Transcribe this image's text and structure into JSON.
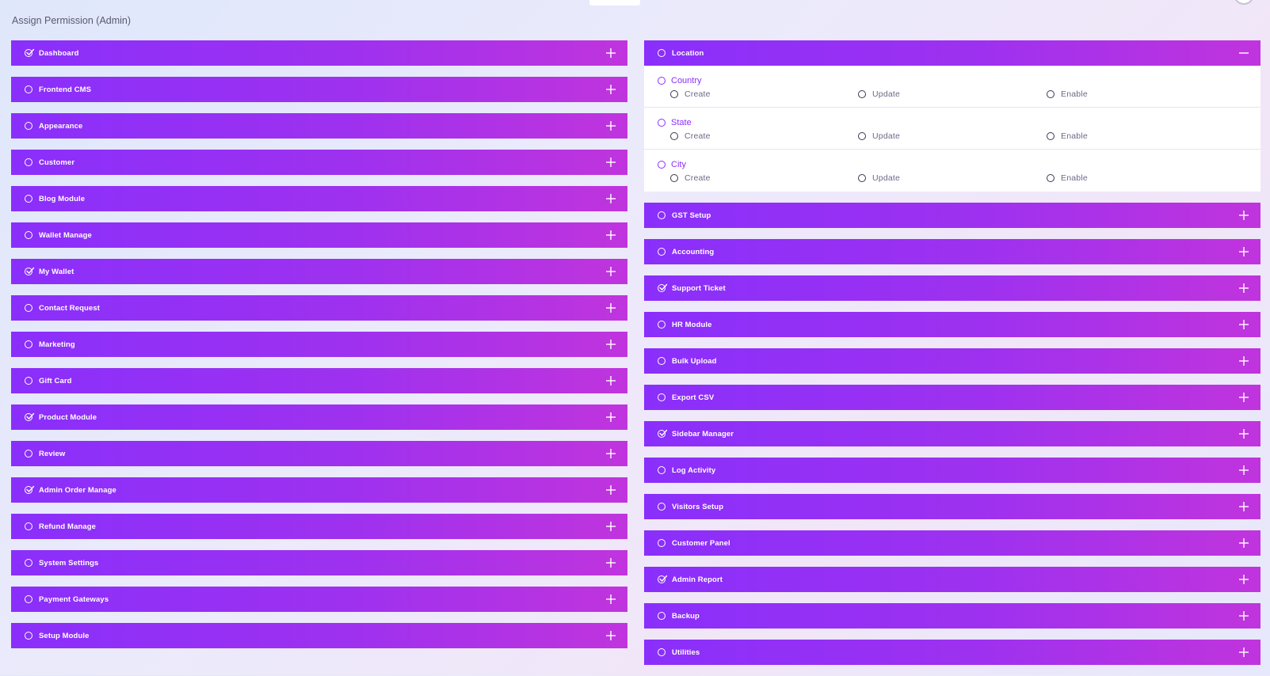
{
  "page": {
    "title": "Assign Permission (Admin)"
  },
  "left_modules": [
    {
      "label": "Dashboard",
      "checked": true,
      "expanded": false
    },
    {
      "label": "Frontend CMS",
      "checked": false,
      "expanded": false
    },
    {
      "label": "Appearance",
      "checked": false,
      "expanded": false
    },
    {
      "label": "Customer",
      "checked": false,
      "expanded": false
    },
    {
      "label": "Blog Module",
      "checked": false,
      "expanded": false
    },
    {
      "label": "Wallet Manage",
      "checked": false,
      "expanded": false
    },
    {
      "label": "My Wallet",
      "checked": true,
      "expanded": false
    },
    {
      "label": "Contact Request",
      "checked": false,
      "expanded": false
    },
    {
      "label": "Marketing",
      "checked": false,
      "expanded": false
    },
    {
      "label": "Gift Card",
      "checked": false,
      "expanded": false
    },
    {
      "label": "Product Module",
      "checked": true,
      "expanded": false
    },
    {
      "label": "Review",
      "checked": false,
      "expanded": false
    },
    {
      "label": "Admin Order Manage",
      "checked": true,
      "expanded": false
    },
    {
      "label": "Refund Manage",
      "checked": false,
      "expanded": false
    },
    {
      "label": "System Settings",
      "checked": false,
      "expanded": false
    },
    {
      "label": "Payment Gateways",
      "checked": false,
      "expanded": false
    },
    {
      "label": "Setup Module",
      "checked": false,
      "expanded": false
    }
  ],
  "right_modules": [
    {
      "label": "Location",
      "checked": false,
      "expanded": true,
      "groups": [
        {
          "label": "Country",
          "actions": [
            "Create",
            "Update",
            "Enable"
          ]
        },
        {
          "label": "State",
          "actions": [
            "Create",
            "Update",
            "Enable"
          ]
        },
        {
          "label": "City",
          "actions": [
            "Create",
            "Update",
            "Enable"
          ]
        }
      ]
    },
    {
      "label": "GST Setup",
      "checked": false,
      "expanded": false
    },
    {
      "label": "Accounting",
      "checked": false,
      "expanded": false
    },
    {
      "label": "Support Ticket",
      "checked": true,
      "expanded": false
    },
    {
      "label": "HR Module",
      "checked": false,
      "expanded": false
    },
    {
      "label": "Bulk Upload",
      "checked": false,
      "expanded": false
    },
    {
      "label": "Export CSV",
      "checked": false,
      "expanded": false
    },
    {
      "label": "Sidebar Manager",
      "checked": true,
      "expanded": false
    },
    {
      "label": "Log Activity",
      "checked": false,
      "expanded": false
    },
    {
      "label": "Visitors Setup",
      "checked": false,
      "expanded": false
    },
    {
      "label": "Customer Panel",
      "checked": false,
      "expanded": false
    },
    {
      "label": "Admin Report",
      "checked": true,
      "expanded": false
    },
    {
      "label": "Backup",
      "checked": false,
      "expanded": false
    },
    {
      "label": "Utilities",
      "checked": false,
      "expanded": false
    }
  ],
  "icons": {
    "checked": "check-circle-icon",
    "unchecked": "empty-circle-icon",
    "expand": "plus-icon",
    "collapse": "minus-icon"
  },
  "colors": {
    "bar_start": "#8a2ffb",
    "bar_end": "#c034dd",
    "accent": "#8a2ffb"
  }
}
